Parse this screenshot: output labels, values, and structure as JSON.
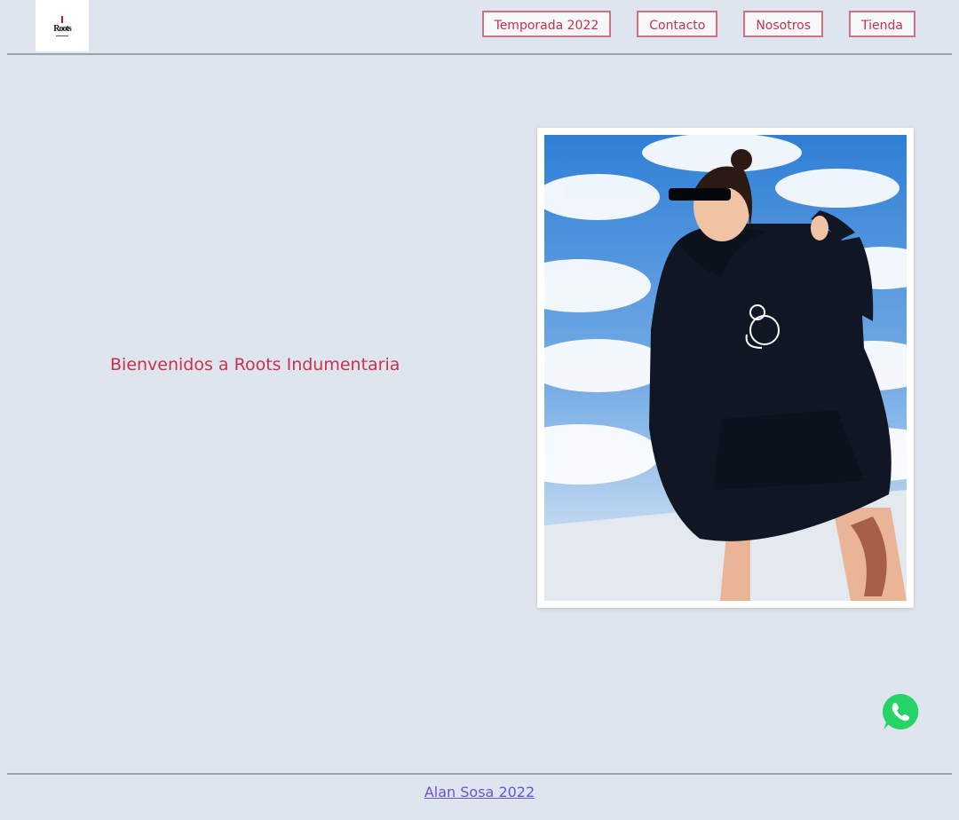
{
  "header": {
    "logo_alt": "Roots",
    "nav": [
      {
        "label": "Temporada 2022"
      },
      {
        "label": "Contacto"
      },
      {
        "label": "Nosotros"
      },
      {
        "label": "Tienda"
      }
    ]
  },
  "hero": {
    "title": "Bienvenidos a Roots Indumentaria",
    "image_icon": "model-photo"
  },
  "whatsapp": {
    "icon": "whatsapp-icon",
    "color": "#25d366"
  },
  "footer": {
    "credit": "Alan Sosa 2022"
  },
  "colors": {
    "background": "#dfe5ee",
    "accent": "#c8324a",
    "link": "#6b52d8"
  }
}
